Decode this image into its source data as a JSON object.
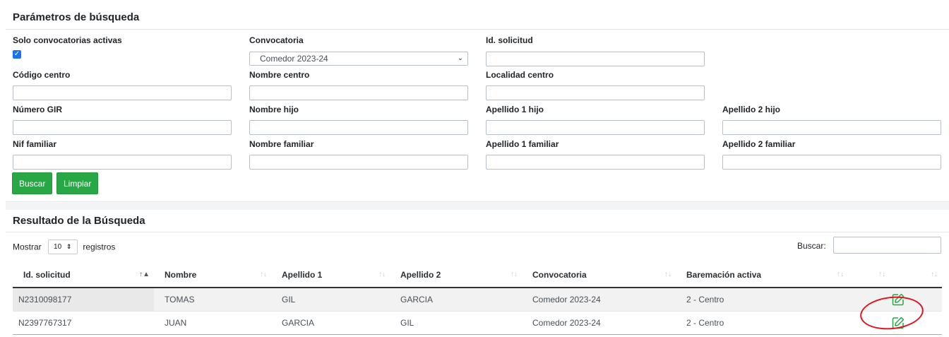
{
  "search_params": {
    "title": "Parámetros de búsqueda",
    "labels": {
      "solo_activas": "Solo convocatorias activas",
      "convocatoria": "Convocatoria",
      "id_solicitud": "Id. solicitud",
      "codigo_centro": "Código centro",
      "nombre_centro": "Nombre centro",
      "localidad_centro": "Localidad centro",
      "numero_gir": "Número GIR",
      "nombre_hijo": "Nombre hijo",
      "apellido1_hijo": "Apellido 1 hijo",
      "apellido2_hijo": "Apellido 2 hijo",
      "nif_familiar": "Nif familiar",
      "nombre_familiar": "Nombre familiar",
      "apellido1_familiar": "Apellido 1 familiar",
      "apellido2_familiar": "Apellido 2 familiar"
    },
    "solo_activas_checked": true,
    "convocatoria_selected": "Comedor 2023-24",
    "buttons": {
      "buscar": "Buscar",
      "limpiar": "Limpiar"
    }
  },
  "results": {
    "title": "Resultado de la Búsqueda",
    "show_prefix": "Mostrar",
    "page_size": "10",
    "show_suffix": "registros",
    "search_label": "Buscar:",
    "columns": [
      "Id. solicitud",
      "Nombre",
      "Apellido 1",
      "Apellido 2",
      "Convocatoria",
      "Baremación activa",
      ""
    ],
    "rows": [
      {
        "id": "N2310098177",
        "nombre": "TOMAS",
        "apellido1": "GIL",
        "apellido2": "GARCIA",
        "convocatoria": "Comedor 2023-24",
        "baremacion": "2 - Centro"
      },
      {
        "id": "N2397767317",
        "nombre": "JUAN",
        "apellido1": "GARCIA",
        "apellido2": "GIL",
        "convocatoria": "Comedor 2023-24",
        "baremacion": "2 - Centro"
      }
    ]
  },
  "colors": {
    "primary_button": "#28a745",
    "checkbox": "#1a73e8",
    "annotation_circle": "#e0141e",
    "edit_icon": "#28a745"
  },
  "icons": {
    "edit": "edit-square-pen-icon"
  }
}
